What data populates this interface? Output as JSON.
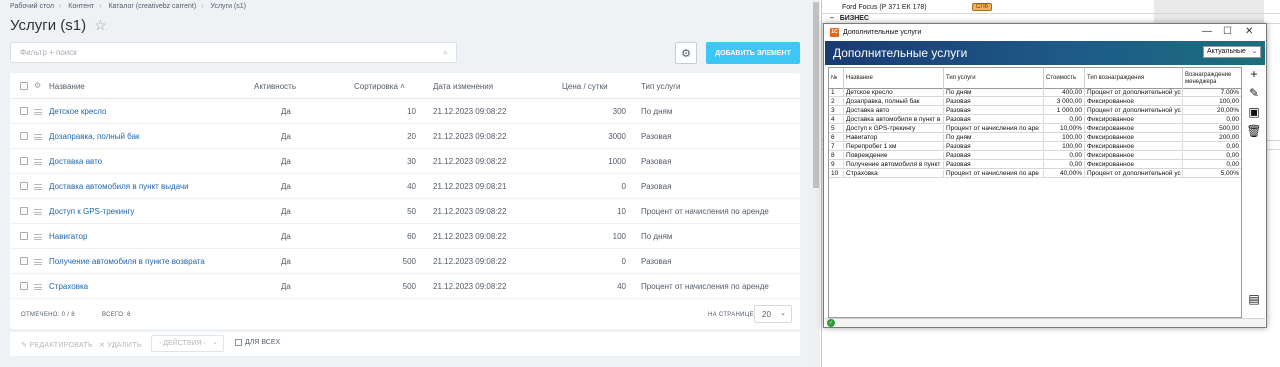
{
  "breadcrumb": [
    "Рабочий стол",
    "Контент",
    "Каталог (creativebz carrent)",
    "Услуги (s1)"
  ],
  "page_title": "Услуги (s1)",
  "search": {
    "placeholder": "Фильтр + поиск"
  },
  "add_button_label": "ДОБАВИТЬ ЭЛЕМЕНТ",
  "table": {
    "columns": {
      "name": "Название",
      "active": "Активность",
      "sort": "Сортировка",
      "date": "Дата изменения",
      "price": "Цена / сутки",
      "type": "Тип услуги"
    },
    "rows": [
      {
        "name": "Детское кресло",
        "active": "Да",
        "sort": "10",
        "date": "21.12.2023 09:08:22",
        "price": "300",
        "type": "По дням"
      },
      {
        "name": "Дозаправка, полный бак",
        "active": "Да",
        "sort": "20",
        "date": "21.12.2023 09:08:22",
        "price": "3000",
        "type": "Разовая"
      },
      {
        "name": "Доставка авто",
        "active": "Да",
        "sort": "30",
        "date": "21.12.2023 09:08:22",
        "price": "1000",
        "type": "Разовая"
      },
      {
        "name": "Доставка автомобиля в пункт выдачи",
        "active": "Да",
        "sort": "40",
        "date": "21.12.2023 09:08:21",
        "price": "0",
        "type": "Разовая"
      },
      {
        "name": "Доступ к GPS-трекингу",
        "active": "Да",
        "sort": "50",
        "date": "21.12.2023 09:08:22",
        "price": "10",
        "type": "Процент от начисления по аренде"
      },
      {
        "name": "Навигатор",
        "active": "Да",
        "sort": "60",
        "date": "21.12.2023 09:08:22",
        "price": "100",
        "type": "По дням"
      },
      {
        "name": "Получение автомобиля в пункте возврата",
        "active": "Да",
        "sort": "500",
        "date": "21.12.2023 09:08:22",
        "price": "0",
        "type": "Разовая"
      },
      {
        "name": "Страховка",
        "active": "Да",
        "sort": "500",
        "date": "21.12.2023 09:08:22",
        "price": "40",
        "type": "Процент от начисления по аренде"
      }
    ]
  },
  "footer": {
    "marked": "ОТМЕЧЕНО: 0 / 8",
    "total": "ВСЕГО: 8",
    "per_page_label": "НА СТРАНИЦЕ:",
    "per_page_value": "20"
  },
  "actions": {
    "edit": "РЕДАКТИРОВАТЬ",
    "delete": "УДАЛИТЬ",
    "actions_select": "- ДЕЙСТВИЯ -",
    "for_all": "ДЛЯ ВСЕХ"
  },
  "background_window": {
    "car_row": "Ford Focus (Р 371 ЕК 178)",
    "city_badge": "СПб",
    "group_row": "БИЗНЕС"
  },
  "dialog": {
    "window_title": "Дополнительные услуги",
    "header": "Дополнительные услуги",
    "filter_value": "Актуальные",
    "columns": {
      "num": "№",
      "name": "Название",
      "type": "Тип услуги",
      "cost": "Стоимость",
      "reward_type": "Тип вознаграждения",
      "manager_reward": "Вознаграждение менеджера"
    },
    "rows": [
      {
        "num": "1",
        "name": "Детское кресло",
        "type": "По дням",
        "cost": "400,00",
        "reward_type": "Процент от дополнительной ус",
        "reward": "7,00%"
      },
      {
        "num": "2",
        "name": "Дозаправка, полный бак",
        "type": "Разовая",
        "cost": "3 000,00",
        "reward_type": "Фиксированное",
        "reward": "100,00"
      },
      {
        "num": "3",
        "name": "Доставка авто",
        "type": "Разовая",
        "cost": "1 000,00",
        "reward_type": "Процент от дополнительной ус",
        "reward": "20,00%"
      },
      {
        "num": "4",
        "name": "Доставка автомобиля в пункт в",
        "type": "Разовая",
        "cost": "0,00",
        "reward_type": "Фиксированное",
        "reward": "0,00"
      },
      {
        "num": "5",
        "name": "Доступ к GPS-трекингу",
        "type": "Процент от начисления по аре",
        "cost": "10,00%",
        "reward_type": "Фиксированное",
        "reward": "500,00"
      },
      {
        "num": "6",
        "name": "Навигатор",
        "type": "По дням",
        "cost": "100,00",
        "reward_type": "Фиксированное",
        "reward": "200,00"
      },
      {
        "num": "7",
        "name": "Перепробег 1 км",
        "type": "Разовая",
        "cost": "100,00",
        "reward_type": "Фиксированное",
        "reward": "0,00"
      },
      {
        "num": "8",
        "name": "Повреждение",
        "type": "Разовая",
        "cost": "0,00",
        "reward_type": "Фиксированное",
        "reward": "0,00"
      },
      {
        "num": "9",
        "name": "Получение автомобиля в пункт",
        "type": "Разовая",
        "cost": "0,00",
        "reward_type": "Фиксированное",
        "reward": "0,00"
      },
      {
        "num": "10",
        "name": "Страховка",
        "type": "Процент от начисления по аре",
        "cost": "40,00%",
        "reward_type": "Процент от дополнительной ус",
        "reward": "5,00%"
      }
    ]
  },
  "colors": {
    "accent": "#3bc8f5",
    "link": "#2067b0",
    "dialog_header": "#1a3a72"
  }
}
